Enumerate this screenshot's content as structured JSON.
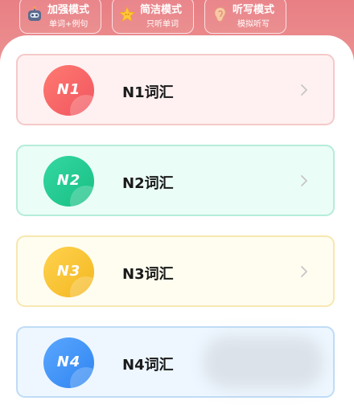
{
  "modes": [
    {
      "title": "加强模式",
      "subtitle": "单词+例句",
      "icon": "robot-icon"
    },
    {
      "title": "简洁模式",
      "subtitle": "只听单词",
      "icon": "star-icon"
    },
    {
      "title": "听写模式",
      "subtitle": "模拟听写",
      "icon": "ear-icon"
    }
  ],
  "levels": [
    {
      "badge": "N1",
      "label": "N1词汇",
      "color": "#f4636a"
    },
    {
      "badge": "N2",
      "label": "N2词汇",
      "color": "#22c98f"
    },
    {
      "badge": "N3",
      "label": "N3词汇",
      "color": "#f7c232"
    },
    {
      "badge": "N4",
      "label": "N4词汇",
      "color": "#3d8ff5"
    }
  ],
  "colors": {
    "header": "#ec8a8b",
    "chevron": "#c6c6c6"
  }
}
